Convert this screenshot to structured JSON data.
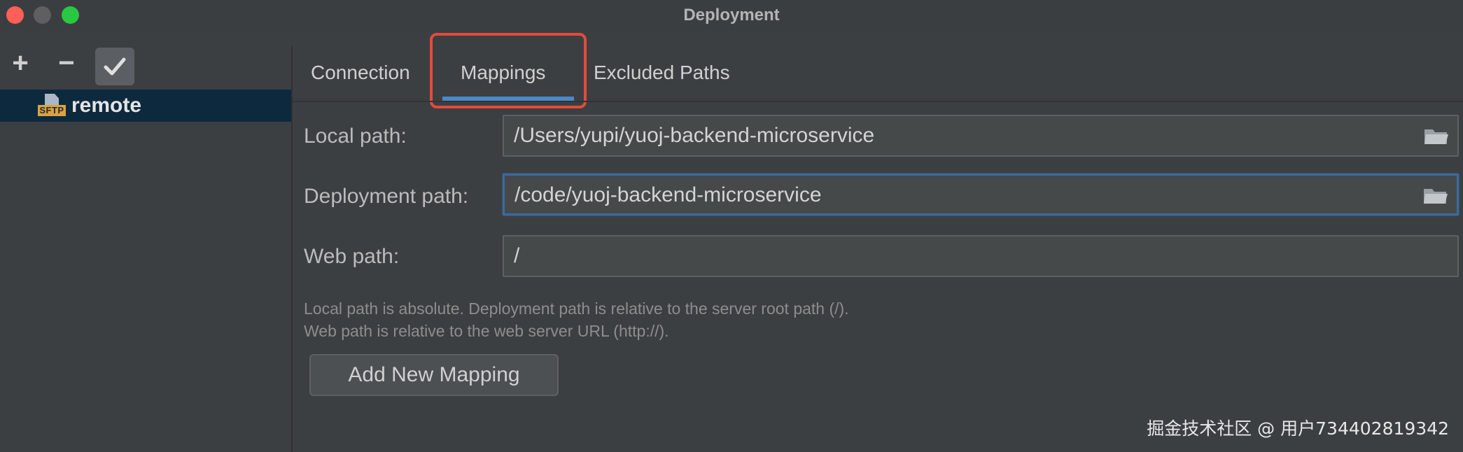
{
  "window": {
    "title": "Deployment"
  },
  "toolbar": {
    "add_label": "+",
    "remove_label": "−"
  },
  "server_tree": {
    "items": [
      {
        "badge": "SFTP",
        "label": "remote",
        "selected": true
      }
    ]
  },
  "tabs": [
    {
      "label": "Connection",
      "selected": false
    },
    {
      "label": "Mappings",
      "selected": true
    },
    {
      "label": "Excluded Paths",
      "selected": false
    }
  ],
  "mappings": {
    "local_path": {
      "label": "Local path:",
      "value": "/Users/yupi/yuoj-backend-microservice"
    },
    "deployment_path": {
      "label": "Deployment path:",
      "value": "/code/yuoj-backend-microservice"
    },
    "web_path": {
      "label": "Web path:",
      "value": "/"
    },
    "hint_line1": "Local path is absolute. Deployment path is relative to the server root path (/).",
    "hint_line2": "Web path is relative to the web server URL (http://).",
    "add_button_label": "Add New Mapping"
  },
  "watermark": "掘金技术社区 @ 用户734402819342",
  "colors": {
    "accent": "#4a88c7",
    "highlight": "#e24b3b",
    "selection": "#0d293e"
  }
}
